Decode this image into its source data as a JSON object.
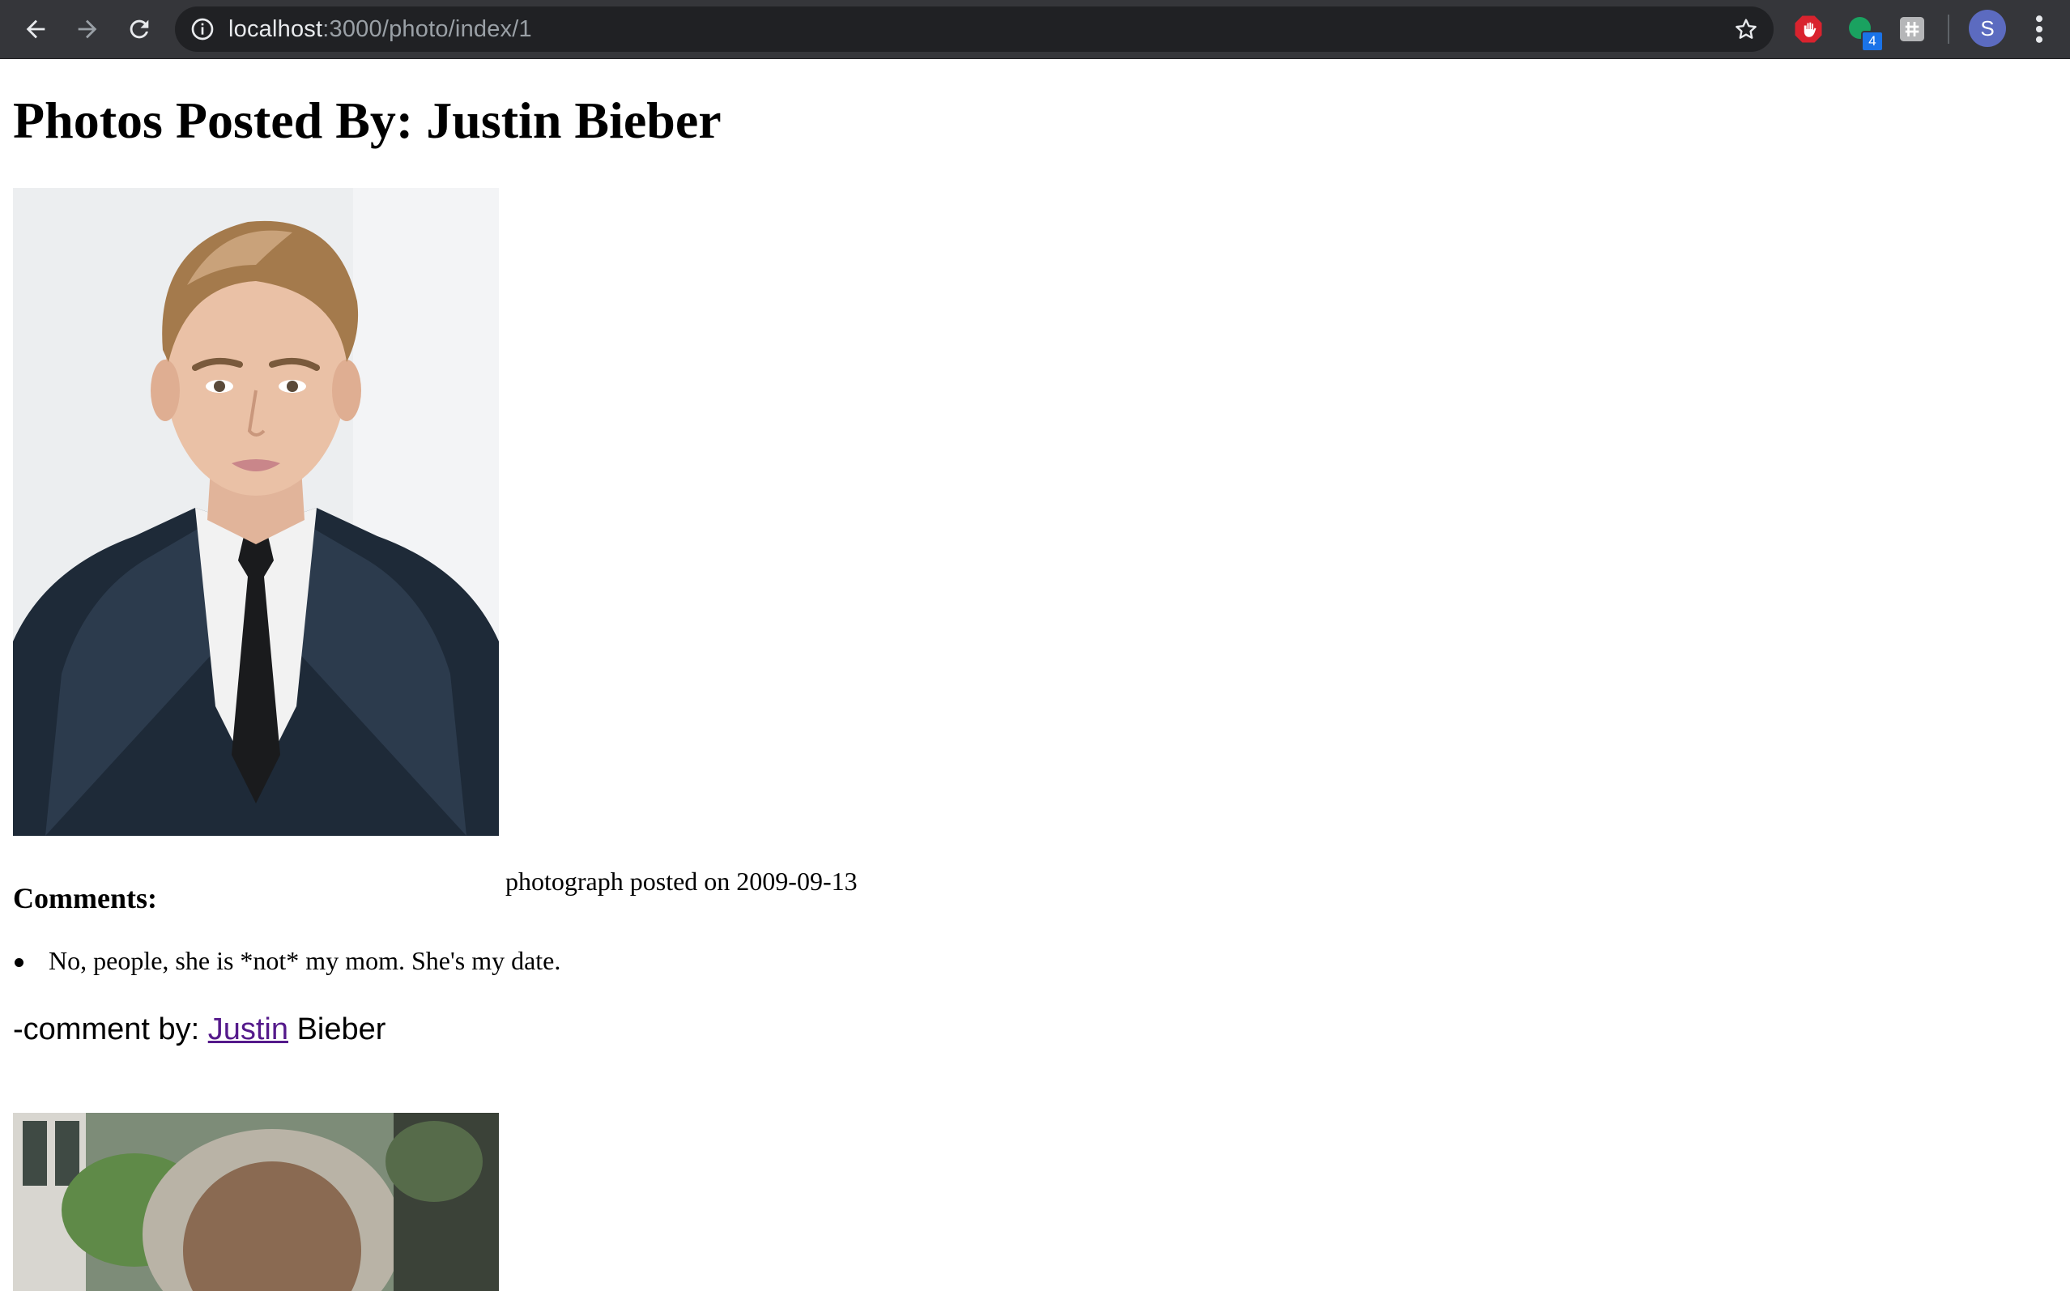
{
  "browser": {
    "url_host": "localhost",
    "url_path": ":3000/photo/index/1",
    "extension_badge": "4",
    "profile_initial": "S",
    "colors": {
      "chrome": "#35363a",
      "omnibox": "#202124",
      "avatar": "#5c6bc0"
    }
  },
  "page": {
    "title": "Photos Posted By: Justin Bieber",
    "photos": [
      {
        "caption": "photograph posted on 2009-09-13",
        "comments_heading": "Comments:",
        "comments": [
          {
            "text": "No, people, she is *not* my mom. She's my date.",
            "by_prefix": "-comment by: ",
            "author_first": "Justin",
            "author_last": " Bieber"
          }
        ]
      }
    ]
  },
  "icons": {
    "back": "arrow-left-icon",
    "forward": "arrow-right-icon",
    "reload": "reload-icon",
    "info": "info-icon",
    "star": "star-icon",
    "ext1": "stop-hand-icon",
    "ext2": "green-circle-icon",
    "ext3": "hash-icon",
    "menu": "kebab-menu-icon"
  },
  "link_color": "#551a8b"
}
